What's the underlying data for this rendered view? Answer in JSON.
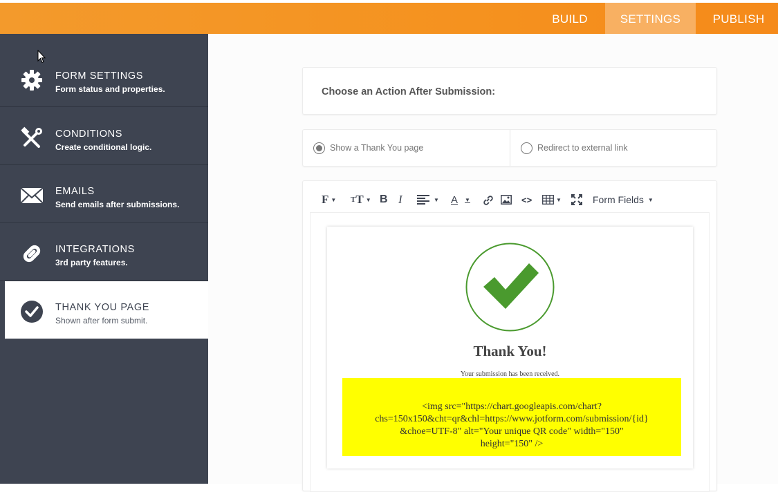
{
  "topnav": {
    "build": "BUILD",
    "settings": "SETTINGS",
    "publish": "PUBLISH"
  },
  "sidebar": {
    "items": [
      {
        "title": "FORM SETTINGS",
        "desc": "Form status and properties.",
        "icon": "gear-icon"
      },
      {
        "title": "CONDITIONS",
        "desc": "Create conditional logic.",
        "icon": "conditions-icon"
      },
      {
        "title": "EMAILS",
        "desc": "Send emails after submissions.",
        "icon": "envelope-icon"
      },
      {
        "title": "INTEGRATIONS",
        "desc": "3rd party features.",
        "icon": "link-icon"
      },
      {
        "title": "THANK YOU PAGE",
        "desc": "Shown after form submit.",
        "icon": "check-circle-icon",
        "active": true
      }
    ]
  },
  "action": {
    "heading": "Choose an Action After Submission:",
    "option_thankyou": "Show a Thank You page",
    "option_redirect": "Redirect to external link",
    "selected": "thankyou"
  },
  "editor": {
    "toolbar": {
      "font": "F",
      "size": "T",
      "bold": "B",
      "italic": "I",
      "color": "A",
      "code": "<>",
      "form_fields": "Form Fields"
    },
    "title": "Thank You!",
    "subtitle": "Your submission has been received.",
    "code_lines": [
      "<img src=\"https://chart.googleapis.com/chart?",
      "chs=150x150&cht=qr&chl=https://www.jotform.com/submission/{id}",
      "&choe=UTF-8\" alt=\"Your unique QR code\" width=\"150\"",
      "height=\"150\" />"
    ]
  },
  "colors": {
    "accent": "#f5921f",
    "sidebar": "#3e4451",
    "check": "#4a9a2e",
    "highlight": "#ffff00"
  }
}
